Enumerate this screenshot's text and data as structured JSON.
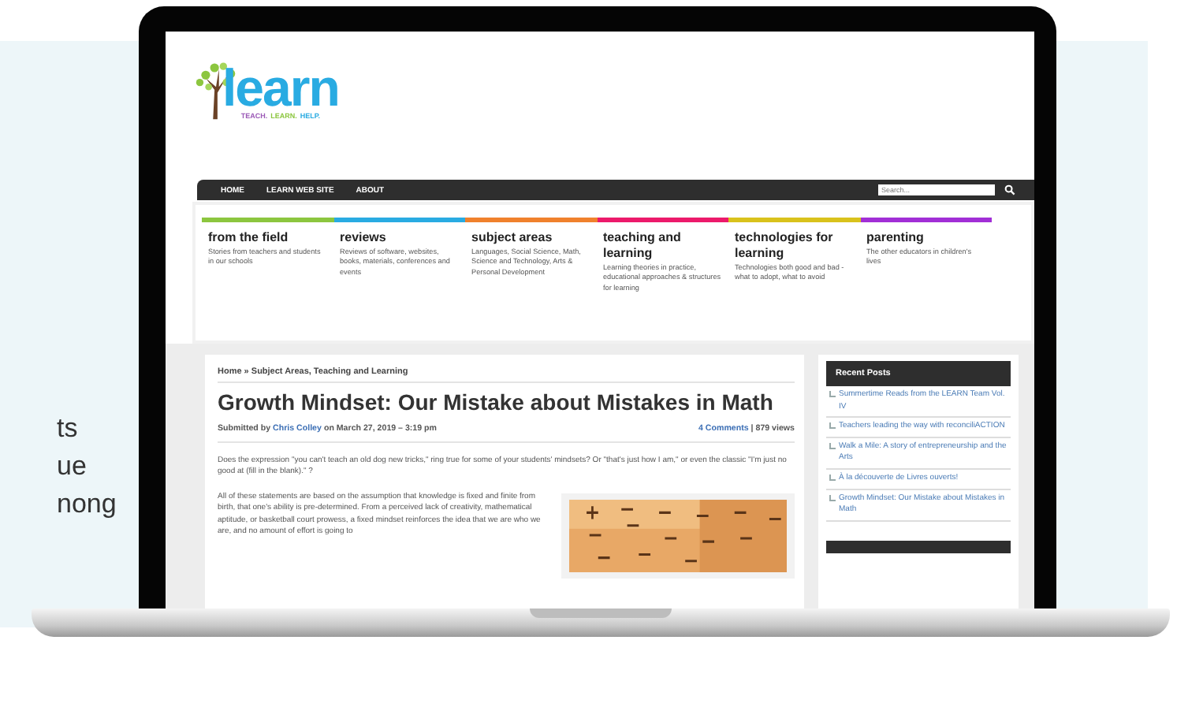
{
  "side_text": [
    "ts",
    "ue",
    "nong"
  ],
  "site": {
    "logo": {
      "name": "learn",
      "tagline": [
        {
          "text": "TEACH.",
          "color": "#9b59b6"
        },
        {
          "text": "LEARN.",
          "color": "#8cc63f"
        },
        {
          "text": "HELP.",
          "color": "#29abe2"
        }
      ]
    },
    "nav": [
      "HOME",
      "LEARN WEB SITE",
      "ABOUT"
    ],
    "search": {
      "placeholder": "Search..."
    },
    "categories": [
      {
        "title": "from the field",
        "description": "Stories from teachers and students in our schools",
        "color": "#8cc63f"
      },
      {
        "title": "reviews",
        "description": "Reviews of software, websites, books, materials, conferences and events",
        "color": "#29abe2"
      },
      {
        "title": "subject areas",
        "description": "Languages, Social Science, Math, Science and Technology, Arts & Personal Development",
        "color": "#f0812d"
      },
      {
        "title": "teaching and learning",
        "description": "Learning theories in practice, educational approaches & structures for learning",
        "color": "#ec1a6b"
      },
      {
        "title": "technologies for learning",
        "description": "Technologies both good and bad - what to adopt, what to avoid",
        "color": "#d9c21c"
      },
      {
        "title": "parenting",
        "description": "The other educators in children's lives",
        "color": "#a12fd6"
      }
    ],
    "article": {
      "breadcrumb": "Home » Subject Areas, Teaching and Learning",
      "title": "Growth Mindset: Our Mistake about Mistakes in Math",
      "meta": {
        "prefix": "Submitted by",
        "author": "Chris Colley",
        "date": "on March 27, 2019 – 3:19 pm",
        "comments": "4 Comments",
        "views": "| 879 views"
      },
      "paragraphs": [
        "Does the expression \"you can't teach an old dog new tricks,\" ring true for some of your students' mindsets? Or \"that's just how I am,\" or even the classic \"I'm just no good at (fill in the blank).\" ?",
        "All of these statements are based on the assumption that knowledge is fixed and finite from birth, that one's ability is pre-determined. From a perceived lack of creativity, mathematical aptitude, or basketball court prowess, a fixed mindset reinforces the idea that we are who we are, and no amount of effort is going to"
      ]
    },
    "sidebar": {
      "title": "Recent Posts",
      "posts": [
        "Summertime Reads from the LEARN Team Vol. IV",
        "Teachers leading the way with reconciliACTION",
        "Walk a Mile: A story of entrepreneurship and the Arts",
        "À la découverte de Livres ouverts!",
        "Growth Mindset: Our Mistake about Mistakes in Math"
      ]
    }
  }
}
